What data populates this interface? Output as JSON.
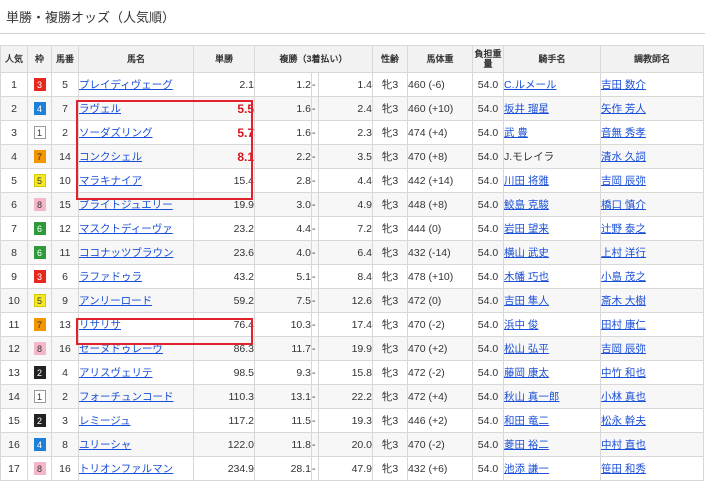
{
  "title": "単勝・複勝オッズ（人気順）",
  "headers": {
    "ninki": "人気",
    "waku": "枠",
    "umaban": "馬番",
    "bamei": "馬名",
    "tansho": "単勝",
    "fukusho": "複勝（3着払い）",
    "seirei": "性齢",
    "bataiju": "馬体重",
    "kinryo": "負担重量",
    "kishu": "騎手名",
    "chokyoshi": "調教師名"
  },
  "waku_colors": {
    "1": {
      "bg": "#ffffff",
      "fg": "#333333",
      "border": "#999999"
    },
    "2": {
      "bg": "#222222",
      "fg": "#ffffff",
      "border": "#222222"
    },
    "3": {
      "bg": "#e8261e",
      "fg": "#ffffff",
      "border": "#e8261e"
    },
    "4": {
      "bg": "#1e7fd8",
      "fg": "#ffffff",
      "border": "#1e7fd8"
    },
    "5": {
      "bg": "#f5e826",
      "fg": "#333333",
      "border": "#d8c800"
    },
    "6": {
      "bg": "#2e9a3a",
      "fg": "#ffffff",
      "border": "#2e9a3a"
    },
    "7": {
      "bg": "#f29600",
      "fg": "#333333",
      "border": "#f29600"
    },
    "8": {
      "bg": "#f6b6c8",
      "fg": "#333333",
      "border": "#f6b6c8"
    }
  },
  "rows": [
    {
      "ninki": "1",
      "waku": "3",
      "umaban": "5",
      "horse": "プレイディヴェーグ",
      "win": "2.1",
      "pmin": "1.2",
      "dash": "-",
      "pmax": "1.4",
      "sex_age": "牝3",
      "weight": "460 (-6)",
      "burden": "54.0",
      "jockey": "C.ルメール",
      "jockey_link": true,
      "trainer": "吉田 数介"
    },
    {
      "ninki": "2",
      "waku": "4",
      "umaban": "7",
      "horse": "ラヴェル",
      "win": "5.5",
      "pmin": "1.6",
      "dash": "-",
      "pmax": "2.4",
      "sex_age": "牝3",
      "weight": "460 (+10)",
      "burden": "54.0",
      "jockey": "坂井 瑠星",
      "jockey_link": true,
      "trainer": "矢作 芳人"
    },
    {
      "ninki": "3",
      "waku": "1",
      "umaban": "2",
      "horse": "ソーダズリング",
      "win": "5.7",
      "pmin": "1.6",
      "dash": "-",
      "pmax": "2.3",
      "sex_age": "牝3",
      "weight": "474 (+4)",
      "burden": "54.0",
      "jockey": "武 豊",
      "jockey_link": true,
      "trainer": "音無 秀孝"
    },
    {
      "ninki": "4",
      "waku": "7",
      "umaban": "14",
      "horse": "コンクシェル",
      "win": "8.1",
      "pmin": "2.2",
      "dash": "-",
      "pmax": "3.5",
      "sex_age": "牝3",
      "weight": "470 (+8)",
      "burden": "54.0",
      "jockey": "J.モレイラ",
      "jockey_link": false,
      "trainer": "清水 久詞"
    },
    {
      "ninki": "5",
      "waku": "5",
      "umaban": "10",
      "horse": "マラキナイア",
      "win": "15.4",
      "pmin": "2.8",
      "dash": "-",
      "pmax": "4.4",
      "sex_age": "牝3",
      "weight": "442 (+14)",
      "burden": "54.0",
      "jockey": "川田 将雅",
      "jockey_link": true,
      "trainer": "吉岡 辰弥"
    },
    {
      "ninki": "6",
      "waku": "8",
      "umaban": "15",
      "horse": "ブライトジュエリー",
      "win": "19.9",
      "pmin": "3.0",
      "dash": "-",
      "pmax": "4.9",
      "sex_age": "牝3",
      "weight": "448 (+8)",
      "burden": "54.0",
      "jockey": "鮫島 克駿",
      "jockey_link": true,
      "trainer": "橋口 慎介"
    },
    {
      "ninki": "7",
      "waku": "6",
      "umaban": "12",
      "horse": "マスクトディーヴァ",
      "win": "23.2",
      "pmin": "4.4",
      "dash": "-",
      "pmax": "7.2",
      "sex_age": "牝3",
      "weight": "444 (0)",
      "burden": "54.0",
      "jockey": "岩田 望来",
      "jockey_link": true,
      "trainer": "辻野 泰之"
    },
    {
      "ninki": "8",
      "waku": "6",
      "umaban": "11",
      "horse": "ココナッツブラウン",
      "win": "23.6",
      "pmin": "4.0",
      "dash": "-",
      "pmax": "6.4",
      "sex_age": "牝3",
      "weight": "432 (-14)",
      "burden": "54.0",
      "jockey": "横山 武史",
      "jockey_link": true,
      "trainer": "上村 洋行"
    },
    {
      "ninki": "9",
      "waku": "3",
      "umaban": "6",
      "horse": "ラファドゥラ",
      "win": "43.2",
      "pmin": "5.1",
      "dash": "-",
      "pmax": "8.4",
      "sex_age": "牝3",
      "weight": "478 (+10)",
      "burden": "54.0",
      "jockey": "木幡 巧也",
      "jockey_link": true,
      "trainer": "小島 茂之"
    },
    {
      "ninki": "10",
      "waku": "5",
      "umaban": "9",
      "horse": "アンリーロード",
      "win": "59.2",
      "pmin": "7.5",
      "dash": "-",
      "pmax": "12.6",
      "sex_age": "牝3",
      "weight": "472 (0)",
      "burden": "54.0",
      "jockey": "吉田 隼人",
      "jockey_link": true,
      "trainer": "斎木 大樹"
    },
    {
      "ninki": "11",
      "waku": "7",
      "umaban": "13",
      "horse": "リサリサ",
      "win": "76.4",
      "pmin": "10.3",
      "dash": "-",
      "pmax": "17.4",
      "sex_age": "牝3",
      "weight": "470 (-2)",
      "burden": "54.0",
      "jockey": "浜中 俊",
      "jockey_link": true,
      "trainer": "田村 康仁"
    },
    {
      "ninki": "12",
      "waku": "8",
      "umaban": "16",
      "horse": "セーヌドゥレーヴ",
      "win": "86.3",
      "pmin": "11.7",
      "dash": "-",
      "pmax": "19.9",
      "sex_age": "牝3",
      "weight": "470 (+2)",
      "burden": "54.0",
      "jockey": "松山 弘平",
      "jockey_link": true,
      "trainer": "吉岡 辰弥"
    },
    {
      "ninki": "13",
      "waku": "2",
      "umaban": "4",
      "horse": "アリスヴェリテ",
      "win": "98.5",
      "pmin": "9.3",
      "dash": "-",
      "pmax": "15.8",
      "sex_age": "牝3",
      "weight": "472 (-2)",
      "burden": "54.0",
      "jockey": "藤岡 康太",
      "jockey_link": true,
      "trainer": "中竹 和也"
    },
    {
      "ninki": "14",
      "waku": "1",
      "umaban": "2",
      "horse": "フォーチュンコード",
      "win": "110.3",
      "pmin": "13.1",
      "dash": "-",
      "pmax": "22.2",
      "sex_age": "牝3",
      "weight": "472 (+4)",
      "burden": "54.0",
      "jockey": "秋山 真一郎",
      "jockey_link": true,
      "trainer": "小林 真也"
    },
    {
      "ninki": "15",
      "waku": "2",
      "umaban": "3",
      "horse": "レミージュ",
      "win": "117.2",
      "pmin": "11.5",
      "dash": "-",
      "pmax": "19.3",
      "sex_age": "牝3",
      "weight": "446 (+2)",
      "burden": "54.0",
      "jockey": "和田 竜二",
      "jockey_link": true,
      "trainer": "松永 幹夫"
    },
    {
      "ninki": "16",
      "waku": "4",
      "umaban": "8",
      "horse": "ユリーシャ",
      "win": "122.0",
      "pmin": "11.8",
      "dash": "-",
      "pmax": "20.0",
      "sex_age": "牝3",
      "weight": "470 (-2)",
      "burden": "54.0",
      "jockey": "菱田 裕二",
      "jockey_link": true,
      "trainer": "中村 直也"
    },
    {
      "ninki": "17",
      "waku": "8",
      "umaban": "16",
      "horse": "トリオンファルマン",
      "win": "234.9",
      "pmin": "28.1",
      "dash": "-",
      "pmax": "47.9",
      "sex_age": "牝3",
      "weight": "432 (+6)",
      "burden": "54.0",
      "jockey": "池添 謙一",
      "jockey_link": true,
      "trainer": "笹田 和秀"
    }
  ],
  "hot_rows": [
    1,
    2,
    3
  ],
  "highlight_color": "#e0222c"
}
